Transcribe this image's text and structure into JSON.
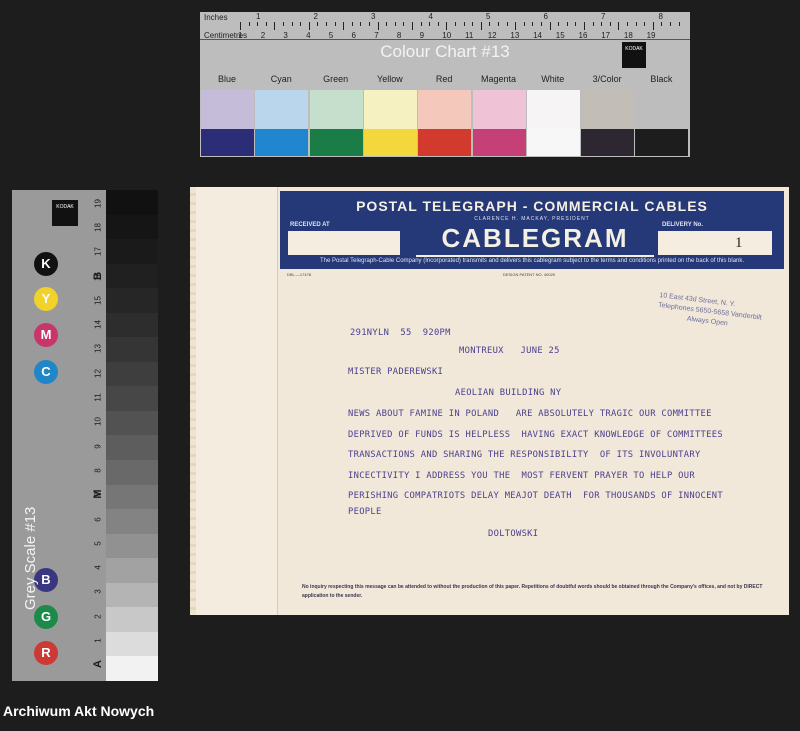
{
  "colour_chart": {
    "title": "Colour Chart #13",
    "ruler_label_inches": "Inches",
    "ruler_label_cm": "Centimetres",
    "inch_numbers": [
      "1",
      "2",
      "3",
      "4",
      "5",
      "6",
      "7",
      "8"
    ],
    "cm_numbers": [
      "1",
      "2",
      "3",
      "4",
      "5",
      "6",
      "7",
      "8",
      "9",
      "10",
      "11",
      "12",
      "13",
      "14",
      "15",
      "16",
      "17",
      "18",
      "19"
    ],
    "logo_text": "KODAK",
    "swatch_names": [
      "Blue",
      "Cyan",
      "Green",
      "Yellow",
      "Red",
      "Magenta",
      "White",
      "3/Color",
      "Black"
    ],
    "swatch_light": [
      "#c5bcda",
      "#b9d6ec",
      "#c6dfcc",
      "#f6f1c0",
      "#f4c8ba",
      "#efc3d5",
      "#f6f4f4",
      "#c3bdb8",
      "#bdbdbd"
    ],
    "swatch_dark": [
      "#2b2d77",
      "#1f86cf",
      "#1a7c47",
      "#f4d63d",
      "#d23a2e",
      "#c54077",
      "#f7f7f7",
      "#2c2730",
      "#1d1d1d"
    ]
  },
  "grey_scale": {
    "title": "Grey Scale #13",
    "logo_text": "KODAK",
    "numbers": [
      "1",
      "2",
      "3",
      "4",
      "5",
      "6",
      "7",
      "8",
      "9",
      "10",
      "11",
      "12",
      "13",
      "14",
      "15",
      "16",
      "17",
      "18",
      "19"
    ],
    "letters": {
      "A": "A",
      "M": "M",
      "B": "B"
    },
    "dots": [
      {
        "letter": "K",
        "color": "#111111"
      },
      {
        "letter": "Y",
        "color": "#f1d12c"
      },
      {
        "letter": "M",
        "color": "#c7356b"
      },
      {
        "letter": "C",
        "color": "#2186c7"
      },
      {
        "letter": "B",
        "color": "#3a3680"
      },
      {
        "letter": "G",
        "color": "#1d8a4b"
      },
      {
        "letter": "R",
        "color": "#cb3a34"
      }
    ],
    "steps": [
      "#111111",
      "#151515",
      "#1a1a1a",
      "#202020",
      "#262626",
      "#2d2d2d",
      "#353535",
      "#3e3e3e",
      "#474747",
      "#525252",
      "#5d5d5d",
      "#696969",
      "#767676",
      "#838383",
      "#919191",
      "#a2a2a2",
      "#b4b4b4",
      "#c8c8c8",
      "#dcdcdc",
      "#f2f2f2"
    ]
  },
  "telegram": {
    "title": "POSTAL TELEGRAPH - COMMERCIAL CABLES",
    "president": "CLARENCE H. MACKAY, PRESIDENT",
    "received_at_label": "RECEIVED AT",
    "cablegram": "CABLEGRAM",
    "delivery_label": "DELIVERY No.",
    "delivery_number": "1",
    "subtitle": "The Postal Telegraph-Cable Company (Incorporated) transmits and delivers this cablegram subject to the terms and conditions printed on the back of this blank.",
    "form_number": "DBL.—17478",
    "design_patent": "DESIGN PATENT NO. 40029",
    "stamp_lines": [
      "10 East 43d Street, N. Y.",
      "Telephones 5650-5658 Vanderbilt",
      "Always Open"
    ],
    "message_lines": [
      "291NYLN  55  920PM",
      "MONTREUX   JUNE 25",
      "MISTER PADEREWSKI",
      "AEOLIAN BUILDING NY",
      "NEWS ABOUT FAMINE IN POLAND   ARE ABSOLUTELY TRAGIC OUR COMMITTEE",
      "DEPRIVED OF FUNDS IS HELPLESS  HAVING EXACT KNOWLEDGE OF COMMITTEES",
      "TRANSACTIONS AND SHARING THE RESPONSIBILITY  OF ITS INVOLUNTARY",
      "INCECTIVITY I ADDRESS YOU THE  MOST FERVENT PRAYER TO HELP OUR",
      "PERISHING COMPATRIOTS DELAY MEAJOT DEATH  FOR THOUSANDS OF INNOCENT",
      "PEOPLE",
      "DOLTOWSKI"
    ],
    "footer": "No inquiry respecting this message can be attended to without the production of this paper.  Repetitions of doubtful words should be obtained through the Company's offices, and not by DIRECT application to the sender."
  },
  "archive_label": "Archiwum Akt Nowych"
}
